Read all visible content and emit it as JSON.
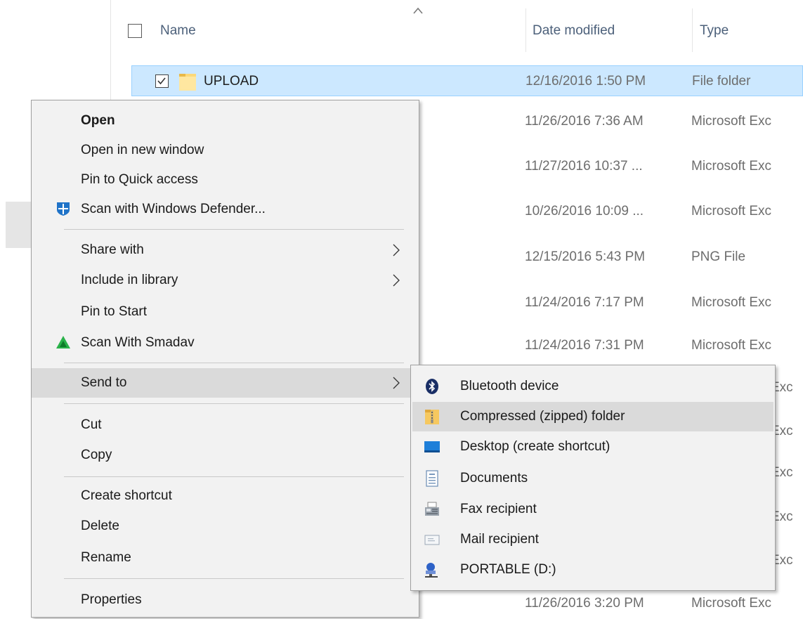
{
  "header": {
    "name_label": "Name",
    "date_label": "Date modified",
    "type_label": "Type"
  },
  "rows": [
    {
      "name": "UPLOAD",
      "date": "12/16/2016 1:50 PM",
      "type": "File folder"
    },
    {
      "date": "11/26/2016 7:36 AM",
      "type": "Microsoft Exc"
    },
    {
      "date": "11/27/2016 10:37 ...",
      "type": "Microsoft Exc"
    },
    {
      "date": "10/26/2016 10:09 ...",
      "type": "Microsoft Exc"
    },
    {
      "date": "12/15/2016 5:43 PM",
      "type": "PNG File"
    },
    {
      "date": "11/24/2016 7:17 PM",
      "type": "Microsoft Exc"
    },
    {
      "date": "11/24/2016 7:31 PM",
      "type": "Microsoft Exc"
    },
    {
      "type": "Exc"
    },
    {
      "type": "Exc"
    },
    {
      "type": "Exc"
    },
    {
      "type": "Exc"
    },
    {
      "type": "Exc"
    },
    {
      "date": "11/26/2016 3:20 PM",
      "type": "Microsoft Exc"
    }
  ],
  "context_menu": {
    "open": "Open",
    "open_new_window": "Open in new window",
    "pin_quick_access": "Pin to Quick access",
    "scan_defender": "Scan with Windows Defender...",
    "share_with": "Share with",
    "include_library": "Include in library",
    "pin_start": "Pin to Start",
    "scan_smadav": "Scan With Smadav",
    "send_to": "Send to",
    "cut": "Cut",
    "copy": "Copy",
    "create_shortcut": "Create shortcut",
    "delete": "Delete",
    "rename": "Rename",
    "properties": "Properties"
  },
  "send_to_menu": {
    "bluetooth": "Bluetooth device",
    "compressed": "Compressed (zipped) folder",
    "desktop": "Desktop (create shortcut)",
    "documents": "Documents",
    "fax": "Fax recipient",
    "mail": "Mail recipient",
    "portable": "PORTABLE (D:)"
  },
  "icons": {
    "folder": "folder-icon",
    "defender": "windows-defender-icon",
    "smadav": "smadav-icon",
    "bluetooth": "bluetooth-icon",
    "zip": "zip-folder-icon",
    "desktop": "desktop-icon",
    "documents": "documents-icon",
    "fax": "fax-icon",
    "mail": "mail-icon",
    "drive": "network-drive-icon"
  },
  "colors": {
    "selection_bg": "#cce8ff",
    "selection_border": "#99d1ff",
    "menu_bg": "#f2f2f2",
    "menu_highlight": "#dadada",
    "header_text": "#4c607a"
  }
}
